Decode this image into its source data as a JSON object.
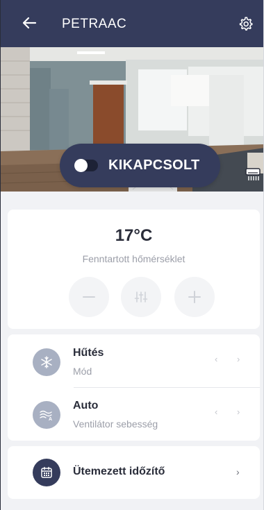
{
  "header": {
    "title": "PETRAAC",
    "back_icon": "arrow-left-icon",
    "settings_icon": "gear-icon",
    "background": "#353c5c"
  },
  "hero": {
    "power_toggle": {
      "label": "KIKAPCSOLT",
      "state": "off"
    },
    "device_icon": "air-conditioner-icon"
  },
  "temperature": {
    "value": "17°C",
    "caption": "Fenntartott hőmérséklet",
    "buttons": [
      "minus-icon",
      "sliders-icon",
      "plus-icon"
    ]
  },
  "mode": {
    "title": "Hűtés",
    "subtitle": "Mód",
    "icon": "snowflake-icon"
  },
  "fan": {
    "title": "Auto",
    "subtitle": "Ventilátor sebesség",
    "icon": "fan-wind-icon"
  },
  "chevrons": {
    "prev": "‹",
    "next": "›"
  },
  "schedule": {
    "title": "Ütemezett időzítő",
    "icon": "calendar-icon",
    "chevron": "›"
  },
  "colors": {
    "primary": "#353c5c",
    "background": "#f1f2f5",
    "muted_text": "#9b9ea8",
    "icon_muted": "#a8b0c2"
  }
}
